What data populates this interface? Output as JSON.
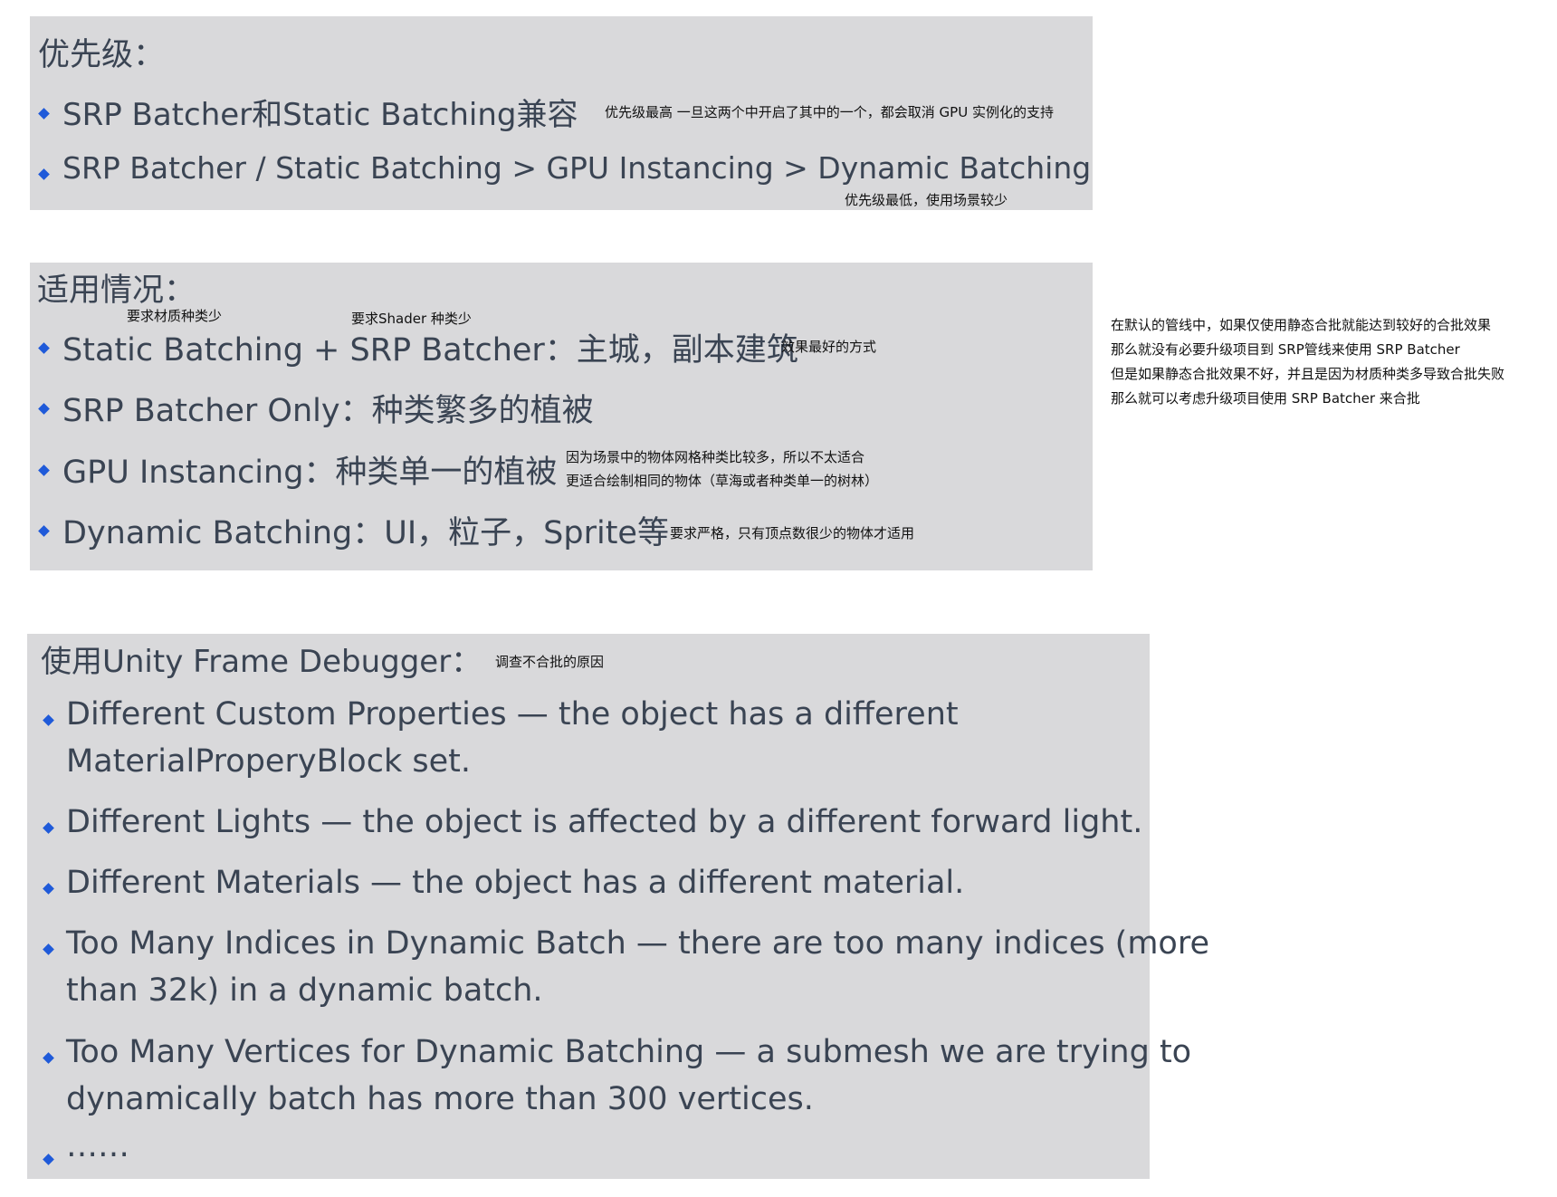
{
  "priority": {
    "title": "优先级：",
    "item1": "SRP Batcher和Static Batching兼容",
    "item1_note": "优先级最高 一旦这两个中开启了其中的一个，都会取消 GPU 实例化的支持",
    "item2": "SRP Batcher / Static Batching > GPU Instancing > Dynamic Batching",
    "item2_note": "优先级最低，使用场景较少"
  },
  "usage": {
    "title": "适用情况：",
    "item1": "Static Batching + SRP Batcher：主城，副本建筑",
    "item1_note_static": "要求材质种类少",
    "item1_note_srp": "要求Shader 种类少",
    "item1_note_best": "效果最好的方式",
    "item2": "SRP Batcher Only：种类繁多的植被",
    "item3": "GPU Instancing：种类单一的植被",
    "item3_note1": "因为场景中的物体网格种类比较多，所以不太适合",
    "item3_note2": "更适合绘制相同的物体（草海或者种类单一的树林）",
    "item4": "Dynamic Batching：UI，粒子，Sprite等",
    "item4_note": "要求严格，只有顶点数很少的物体才适用"
  },
  "side_note": {
    "line1": "在默认的管线中，如果仅使用静态合批就能达到较好的合批效果",
    "line2": "那么就没有必要升级项目到 SRP管线来使用 SRP Batcher",
    "line3": "但是如果静态合批效果不好，并且是因为材质种类多导致合批失败",
    "line4": "那么就可以考虑升级项目使用 SRP Batcher 来合批"
  },
  "debugger": {
    "title": "使用Unity Frame Debugger：",
    "title_note": "调查不合批的原因",
    "item1_line1": "Different Custom Properties — the object has a different",
    "item1_line2": "MaterialProperyBlock set.",
    "item2": "Different Lights — the object is affected by a different forward light.",
    "item3": "Different Materials — the object has a different material.",
    "item4_line1": "Too Many Indices in Dynamic Batch — there are too many indices (more",
    "item4_line2": "than 32k) in a dynamic batch.",
    "item5_line1": "Too Many Vertices for Dynamic Batching — a submesh we are trying to",
    "item5_line2": "dynamically batch has more than 300 vertices.",
    "item6": "……"
  },
  "colors": {
    "panel_bg": "#d9d9db",
    "text": "#3a4453",
    "bullet": "#1f5ad9",
    "annotation": "#111111"
  }
}
